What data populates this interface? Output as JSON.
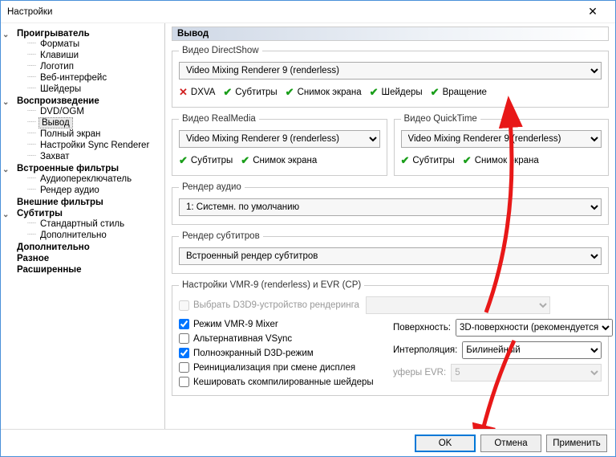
{
  "window": {
    "title": "Настройки"
  },
  "sidebar": {
    "player": "Проигрыватель",
    "player_items": [
      "Форматы",
      "Клавиши",
      "Логотип",
      "Веб-интерфейс",
      "Шейдеры"
    ],
    "playback": "Воспроизведение",
    "playback_items": [
      "DVD/OGM",
      "Вывод",
      "Полный экран",
      "Настройки Sync Renderer",
      "Захват"
    ],
    "internal": "Встроенные фильтры",
    "internal_items": [
      "Аудиопереключатель",
      "Рендер аудио"
    ],
    "external": "Внешние фильтры",
    "subtitles": "Субтитры",
    "subtitles_items": [
      "Стандартный стиль",
      "Дополнительно"
    ],
    "additional": "Дополнительно",
    "misc": "Разное",
    "advanced": "Расширенные",
    "active": "Вывод"
  },
  "page": {
    "title": "Вывод",
    "ds": {
      "legend": "Видео DirectShow",
      "combo": "Video Mixing Renderer 9 (renderless)",
      "features": {
        "dxva": {
          "ok": false,
          "label": "DXVA"
        },
        "sub": {
          "ok": true,
          "label": "Субтитры"
        },
        "shot": {
          "ok": true,
          "label": "Снимок экрана"
        },
        "shad": {
          "ok": true,
          "label": "Шейдеры"
        },
        "rot": {
          "ok": true,
          "label": "Вращение"
        }
      }
    },
    "rm": {
      "legend": "Видео RealMedia",
      "combo": "Video Mixing Renderer 9 (renderless)",
      "sub": {
        "ok": true,
        "label": "Субтитры"
      },
      "shot": {
        "ok": true,
        "label": "Снимок экрана"
      }
    },
    "qt": {
      "legend": "Видео QuickTime",
      "combo": "Video Mixing Renderer 9 (renderless)",
      "sub": {
        "ok": true,
        "label": "Субтитры"
      },
      "shot": {
        "ok": true,
        "label": "Снимок экрана"
      }
    },
    "audio": {
      "legend": "Рендер аудио",
      "combo": "1: Системн. по умолчанию"
    },
    "subr": {
      "legend": "Рендер субтитров",
      "combo": "Встроенный рендер субтитров"
    },
    "vmr": {
      "legend": "Настройки VMR-9 (renderless) и EVR (CP)",
      "d3d9": "Выбрать D3D9-устройство рендеринга",
      "mixer": "Режим VMR-9 Mixer",
      "altvsync": "Альтернативная VSync",
      "d3dfs": "Полноэкранный D3D-режим",
      "reinit": "Реинициализация при смене дисплея",
      "cacheshaders": "Кешировать скомпилированные шейдеры",
      "surface_label": "Поверхность:",
      "surface_value": "3D-поверхности (рекомендуется",
      "interp_label": "Интерполяция:",
      "interp_value": "Билинейный",
      "evrbuf_label": "уферы EVR:",
      "evrbuf_value": "5"
    }
  },
  "footer": {
    "ok": "OK",
    "cancel": "Отмена",
    "apply": "Применить"
  }
}
